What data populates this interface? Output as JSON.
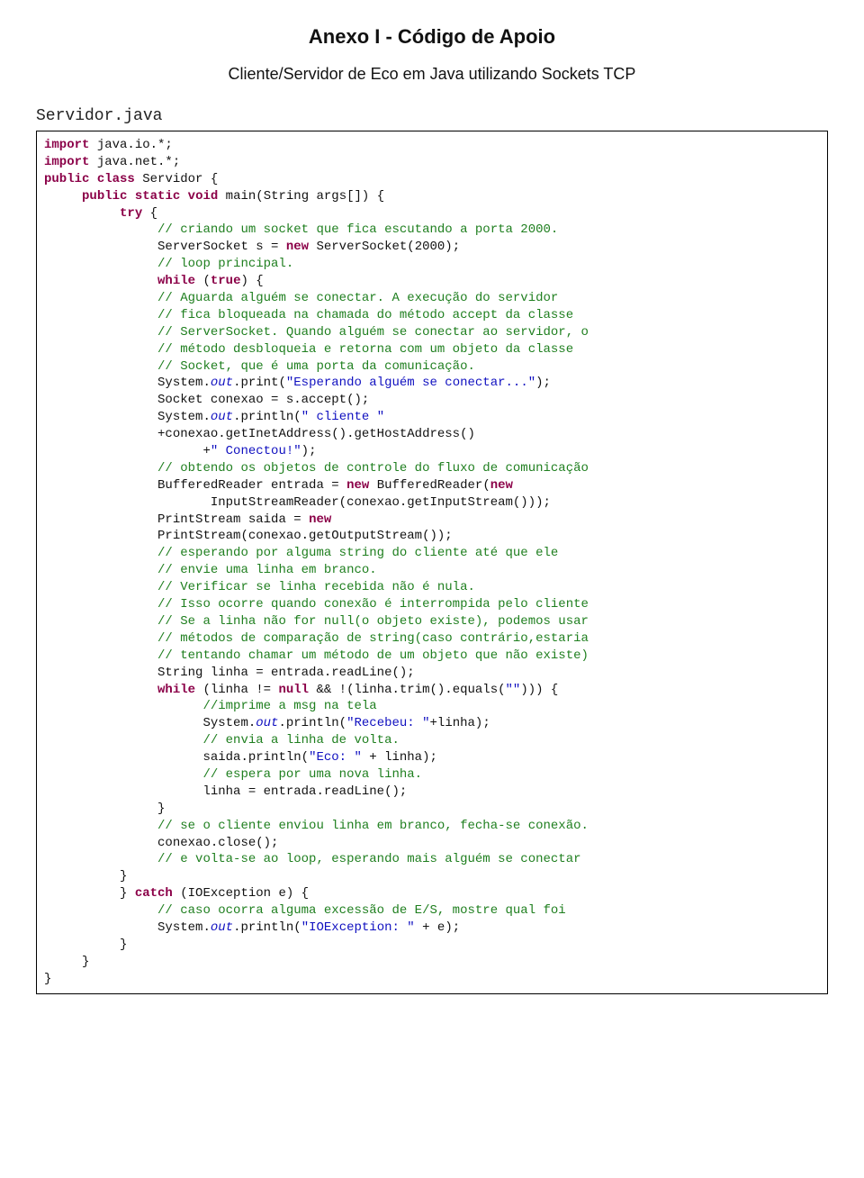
{
  "doc": {
    "title": "Anexo I - Código de Apoio",
    "subtitle": "Cliente/Servidor de Eco em Java utilizando Sockets TCP",
    "file_label": "Servidor.java"
  },
  "kw": {
    "import": "import",
    "public": "public",
    "class": "class",
    "static": "static",
    "void": "void",
    "try": "try",
    "new": "new",
    "while": "while",
    "true": "true",
    "catch": "catch",
    "null": "null"
  },
  "cm": {
    "c1": "// criando um socket que fica escutando a porta 2000.",
    "c2": "// loop principal.",
    "c3": "// Aguarda alguém se conectar. A execução do servidor",
    "c4": "// fica bloqueada na chamada do método accept da classe",
    "c5": "// ServerSocket. Quando alguém se conectar ao servidor, o",
    "c6": "// método desbloqueia e retorna com um objeto da classe",
    "c7": "// Socket, que é uma porta da comunicação.",
    "c8": "// obtendo os objetos de controle do fluxo de comunicação",
    "c9": "// esperando por alguma string do cliente até que ele",
    "c10": "// envie uma linha em branco.",
    "c11": "// Verificar se linha recebida não é nula.",
    "c12": "// Isso ocorre quando conexão é interrompida pelo cliente",
    "c13": "// Se a linha não for null(o objeto existe), podemos usar",
    "c14": "// métodos de comparação de string(caso contrário,estaria",
    "c15": "// tentando chamar um método de um objeto que não existe)",
    "c16": "//imprime a msg na tela",
    "c17": "// envia a linha de volta.",
    "c18": "// espera por uma nova linha.",
    "c19": "// se o cliente enviou linha em branco, fecha-se conexão.",
    "c20": "// e volta-se ao loop, esperando mais alguém se conectar",
    "c21": "// caso ocorra alguma excessão de E/S, mostre qual foi"
  },
  "str": {
    "s1": "\"Esperando alguém se conectar...\"",
    "s2": "\" cliente \"",
    "s3": "\" Conectou!\"",
    "s4": "\"\"",
    "s5": "\"Recebeu: \"",
    "s6": "\"Eco: \"",
    "s7": "\"IOException: \""
  },
  "code": {
    "pkg_io": " java.io.*;",
    "pkg_net": " java.net.*;",
    "cls_servidor": " Servidor {",
    "main_sig": " main(String args[]) {",
    "try_open": " {",
    "ss_decl1": "ServerSocket s = ",
    "ss_decl2": " ServerSocket(2000);",
    "while_open": " (",
    "while_close": ") {",
    "sysout": "System.",
    "out": "out",
    "print": ".print(",
    "println": ".println(",
    "close_paren_semi": ");",
    "socket_accept": "Socket conexao = s.accept();",
    "concat_conexao": "+conexao.getInetAddress().getHostAddress()",
    "plus_str_close": "      +",
    "buffered1": "BufferedReader entrada = ",
    "buffered2": " BufferedReader(",
    "buffered3": "       InputStreamReader(conexao.getInputStream()));",
    "printstream1": "PrintStream saida = ",
    "printstream2": "PrintStream(conexao.getOutputStream());",
    "readline": "String linha = entrada.readLine();",
    "while2_a": " (linha != ",
    "while2_b": " && !(linha.trim().equals(",
    "while2_c": "))) {",
    "recebeu_tail": "+linha);",
    "eco_tail": " + linha);",
    "saida_println": "saida.println(",
    "linha_read": "linha = entrada.readLine();",
    "brace_close": "}",
    "conexao_close": "conexao.close();",
    "catch_sig": " (IOException e) {",
    "ioexc_tail": " + e);"
  }
}
